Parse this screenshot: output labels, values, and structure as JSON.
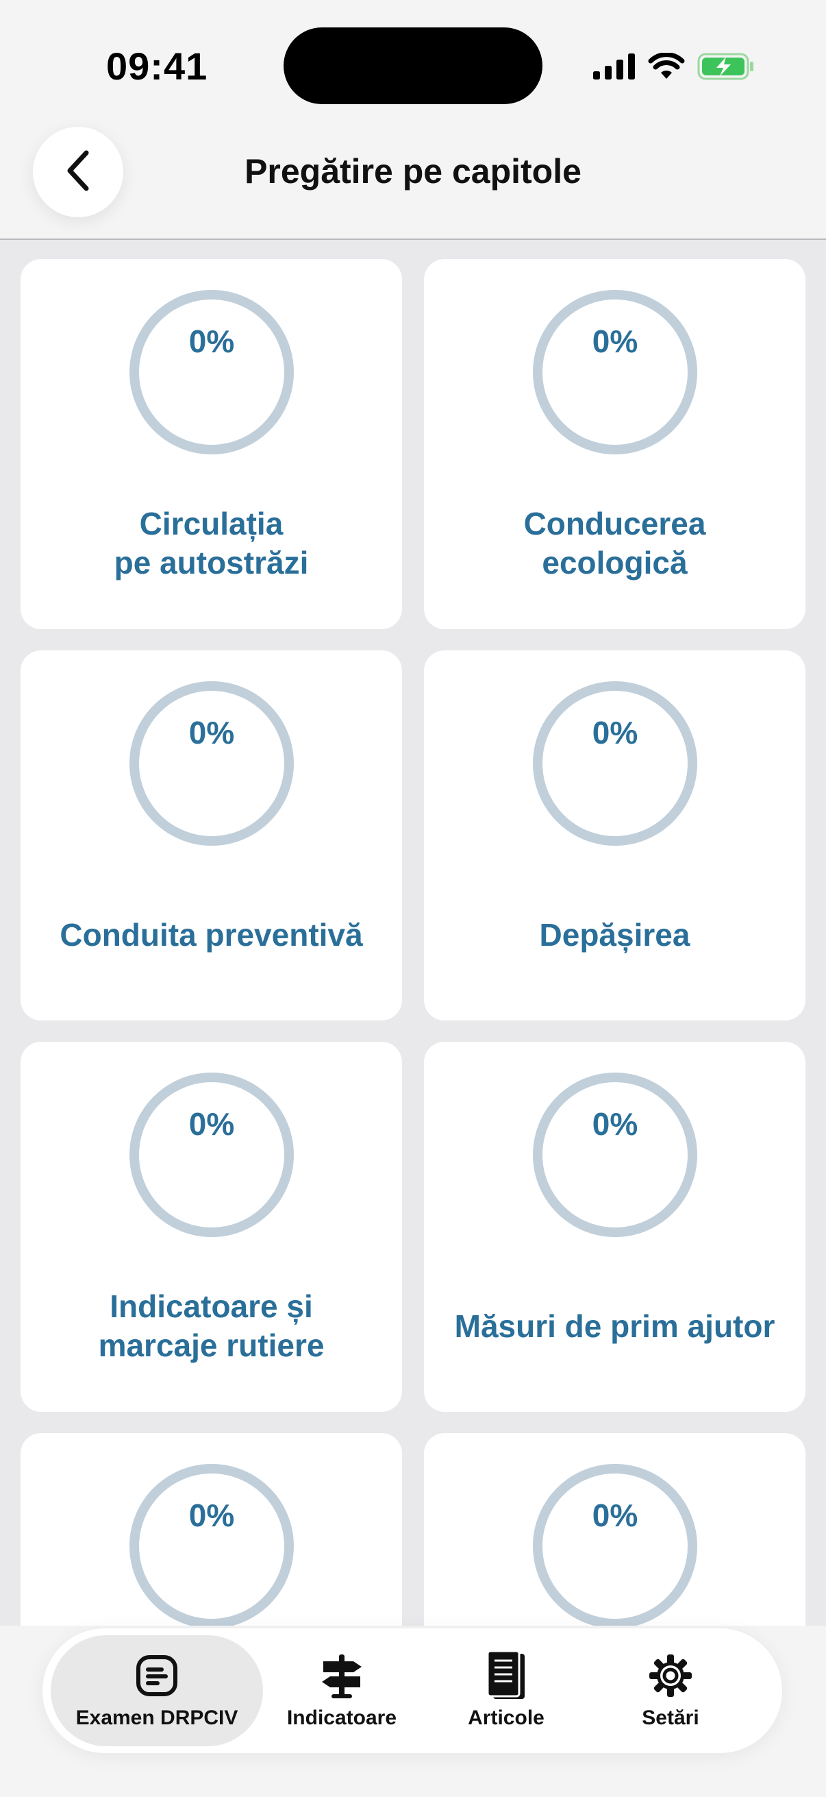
{
  "status_bar": {
    "time": "09:41"
  },
  "header": {
    "title": "Pregătire pe capitole",
    "back_icon": "chevron-left-icon"
  },
  "chapters": [
    {
      "progress_label": "0%",
      "progress": 0,
      "title": "Circulația\npe autostrăzi"
    },
    {
      "progress_label": "0%",
      "progress": 0,
      "title": "Conducerea\necologică"
    },
    {
      "progress_label": "0%",
      "progress": 0,
      "title": "Conduita preventivă"
    },
    {
      "progress_label": "0%",
      "progress": 0,
      "title": "Depășirea"
    },
    {
      "progress_label": "0%",
      "progress": 0,
      "title": "Indicatoare și\nmarcaje rutiere"
    },
    {
      "progress_label": "0%",
      "progress": 0,
      "title": "Măsuri de prim ajutor"
    },
    {
      "progress_label": "0%",
      "progress": 0,
      "title": ""
    },
    {
      "progress_label": "0%",
      "progress": 0,
      "title": ""
    }
  ],
  "tabbar": {
    "tabs": [
      {
        "label": "Examen DRPCIV",
        "icon": "document-text-icon",
        "active": true
      },
      {
        "label": "Indicatoare",
        "icon": "signpost-icon",
        "active": false
      },
      {
        "label": "Articole",
        "icon": "book-icon",
        "active": false
      },
      {
        "label": "Setări",
        "icon": "gear-icon",
        "active": false
      }
    ]
  },
  "colors": {
    "accent": "#2a6f99",
    "ring": "#c0cfda",
    "background": "#e9e9ec",
    "card": "#ffffff"
  }
}
